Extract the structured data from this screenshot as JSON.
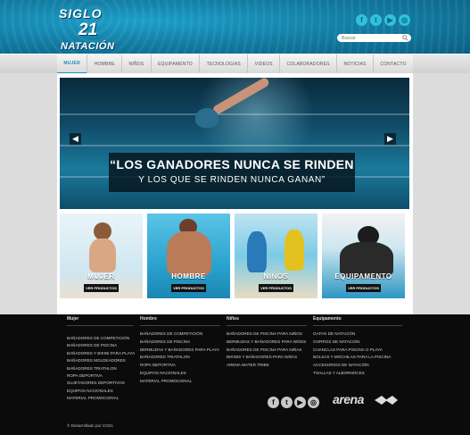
{
  "brand": {
    "logo_line1": "SIGLO",
    "logo_line2": "21",
    "logo_line3": "NATACIÓN"
  },
  "header": {
    "social_icons": [
      "facebook-icon",
      "twitter-icon",
      "youtube-icon",
      "instagram-icon"
    ],
    "search_placeholder": "Buscar"
  },
  "nav": {
    "items": [
      {
        "label": "MUJER",
        "active": true
      },
      {
        "label": "HOMBRE",
        "active": false
      },
      {
        "label": "NIÑOS",
        "active": false
      },
      {
        "label": "EQUIPAMENTO",
        "active": false
      },
      {
        "label": "TECNOLOGIAS",
        "active": false
      },
      {
        "label": "VIDEOS",
        "active": false
      },
      {
        "label": "COLABORADORES",
        "active": false
      },
      {
        "label": "NOTICIAS",
        "active": false
      },
      {
        "label": "CONTACTO",
        "active": false
      }
    ]
  },
  "hero": {
    "quote_line1": "“LOS GANADORES NUNCA SE RINDEN",
    "quote_line2": "Y LOS QUE SE RINDEN NUNCA GANAN”",
    "prev_glyph": "◀",
    "next_glyph": "▶"
  },
  "tiles": [
    {
      "label": "MUJER",
      "button": "VER PRODUCTOS"
    },
    {
      "label": "HOMBRE",
      "button": "VER PRODUCTOS"
    },
    {
      "label": "NIÑOS",
      "button": "VER PRODUCTOS"
    },
    {
      "label": "EQUIPAMENTO",
      "button": "VER PRODUCTOS"
    }
  ],
  "footer": {
    "columns": [
      {
        "heading": "Mujer",
        "items": [
          "BAÑADORES DE COMPETICIÓN",
          "BAÑADORES DE PISCINA",
          "BAÑADORES Y BIKINI PARA PLAYA",
          "BAÑADORES MOLDEADORES",
          "BAÑADORES TRIATHLON",
          "ROPA DEPORTIVA",
          "SUJETADORES DEPORTIVOS",
          "EQUIPOS NACIONALES",
          "MATERIAL PROMOCIONAL"
        ]
      },
      {
        "heading": "Hombre",
        "items": [
          "BAÑADORES DE COMPETICIÓN",
          "BAÑADORES DE PISCINA",
          "BERMUDAS Y BAÑADORES PARA PLAYA",
          "BAÑADORES TRIATHLON",
          "ROPA DEPORTIVA",
          "EQUIPOS NACIONALES",
          "MATERIAL PROMOCIONAL"
        ]
      },
      {
        "heading": "Niños",
        "items": [
          "BAÑADORES DE PISCINA PARA NIÑOS",
          "BERMUDAS Y BAÑADORES PARA NIÑOS",
          "BAÑADORES DE PISCINA PARA NIÑAS",
          "BIKINIS Y BAÑADORES PARA NIÑAS",
          "ARENA WATER TRIBE"
        ]
      },
      {
        "heading": "Equipamento",
        "items": [
          "GAFAS DE NATACIÓN",
          "GORROS DE NATACIÓN",
          "CHANCLAS PARA PISCINA O PLAYA",
          "BOLSAS Y MOCHILAS PARA LA PISCINA",
          "ACCESORIOS DE NATACIÓN",
          "TOALLAS Y ALBORNOCES"
        ]
      }
    ],
    "social_icons": [
      "facebook-icon",
      "twitter-icon",
      "youtube-icon",
      "instagram-icon"
    ],
    "partner_brand": "arena",
    "copyright": "© Desarrollado por CO21"
  },
  "colors": {
    "accent": "#1a8fc0",
    "header_blue": "#137fa6",
    "footer_bg": "#0b0b0b"
  }
}
